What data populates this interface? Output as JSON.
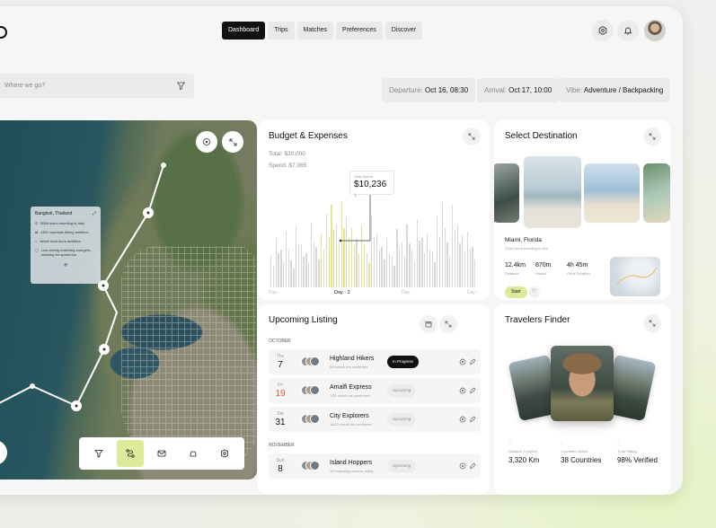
{
  "nav": {
    "items": [
      "Dashboard",
      "Trips",
      "Matches",
      "Preferences",
      "Discover"
    ],
    "active": 0
  },
  "search": {
    "placeholder": "Where we go?"
  },
  "filters": {
    "departure_label": "Departure:",
    "departure_value": "Oct 16, 08:30",
    "arrival_label": "Arrival:",
    "arrival_value": "Oct 17, 10:00",
    "vibe_label": "Vibe:",
    "vibe_value": "Adventure / Backpacking"
  },
  "map": {
    "info": {
      "title": "Bangkok, Thailand",
      "lines": [
        "5048 users traveling to Italy",
        "45% mountain biking ambition",
        "wheel food tours ambition",
        "Low driving matching energetic, washing for sports fan"
      ]
    }
  },
  "budget": {
    "title": "Budget & Expenses",
    "total_label": "Total:",
    "total": "$20,000",
    "spend_label": "Spend:",
    "spend": "$7,065",
    "tooltip_label": "Total Spend",
    "tooltip_value": "$10,236",
    "xlabels": [
      "Day -",
      "Day - 2",
      "Day -",
      "Day -"
    ],
    "bars": [
      0.35,
      0.55,
      0.42,
      0.62,
      0.3,
      0.68,
      0.48,
      0.38,
      0.72,
      0.45,
      0.6,
      0.82,
      0.92,
      0.7,
      0.95,
      0.78,
      0.66,
      0.54,
      0.7,
      0.38,
      0.8,
      0.6,
      0.45,
      0.55,
      0.35,
      0.65,
      0.5,
      0.7,
      0.42,
      0.75,
      0.55,
      0.6,
      0.4,
      0.8,
      0.95,
      0.5,
      0.92,
      0.7,
      0.58,
      0.62,
      0.45
    ],
    "highlighted_range": [
      10,
      19
    ]
  },
  "destination": {
    "title": "Select Destination",
    "place": "Miami, Florida",
    "place_sub": "2248 users traveling to this",
    "stats": [
      {
        "value": "12.4km",
        "label": "Distance"
      },
      {
        "value": "870m",
        "label": "Strava"
      },
      {
        "value": "4h 45m",
        "label": "Drive Duration"
      }
    ],
    "start_label": "Start"
  },
  "listing": {
    "title": "Upcoming Listing",
    "months": [
      "OCTOBER",
      "NOVEMBER"
    ],
    "rows": [
      {
        "dow": "Thu",
        "day": "7",
        "name": "Highland Hikers",
        "sub": "5/9 check-ins confirmed",
        "status": "In Progress",
        "dark": true,
        "red": false
      },
      {
        "dow": "Fri",
        "day": "19",
        "name": "Amalfi Express",
        "sub": "7/20 check-ins confirmed",
        "status": "Upcoming",
        "dark": false,
        "red": true
      },
      {
        "dow": "Sat",
        "day": "31",
        "name": "City Explorers",
        "sub": "10/12 check-ins confirmed",
        "status": "Upcoming",
        "dark": false,
        "red": false
      },
      {
        "dow": "Sun",
        "day": "8",
        "name": "Island Hoppers",
        "sub": "4/9 boarding process ready",
        "status": "Upcoming",
        "dark": false,
        "red": false
      }
    ]
  },
  "finder": {
    "title": "Travelers Finder",
    "stats": [
      {
        "label": "Distance Covered",
        "value": "3,320 Km"
      },
      {
        "label": "Countries Visited",
        "value": "38 Countries"
      },
      {
        "label": "Trust Rating",
        "value": "98% Verified"
      }
    ]
  },
  "colors": {
    "accent": "#dfe99a",
    "dark": "#111111",
    "danger": "#e5533d"
  }
}
